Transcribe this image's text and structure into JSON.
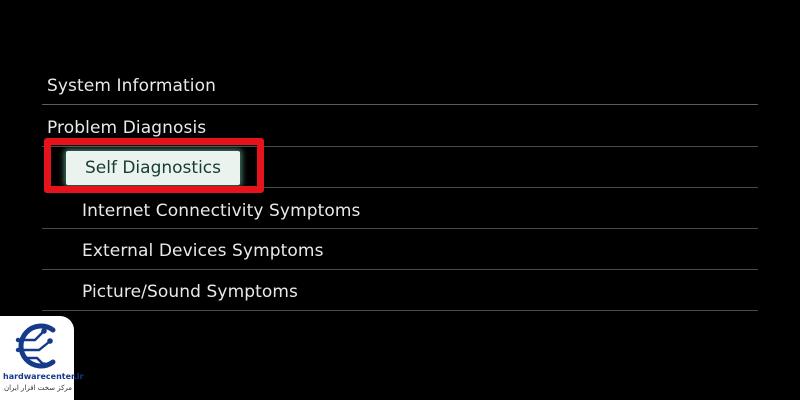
{
  "menu": {
    "items": [
      {
        "label": "System Information"
      },
      {
        "label": "Problem Diagnosis"
      },
      {
        "label": "Self Diagnostics",
        "selected": true
      },
      {
        "label": "Internet Connectivity Symptoms"
      },
      {
        "label": "External Devices Symptoms"
      },
      {
        "label": "Picture/Sound Symptoms"
      }
    ]
  },
  "annotation": {
    "highlight_color": "#e5131b",
    "target": "Self Diagnostics"
  },
  "watermark": {
    "domain": "hardwarecenter.ir",
    "tagline": "مرکز سخت افزار ایران",
    "icon": "circuit-logo-icon",
    "brand_color": "#163a8a"
  },
  "colors": {
    "background": "#000000",
    "text": "#e9e9e9",
    "selected_bg": "#eaf3ee",
    "selected_text": "#1a3a34",
    "selected_glow": "#78dcbe"
  }
}
